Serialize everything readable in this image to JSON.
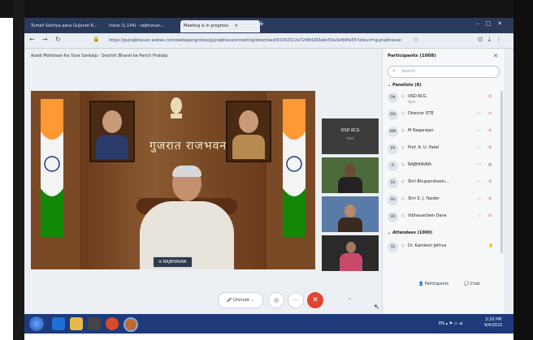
{
  "browser": {
    "tabs": [
      {
        "label": "Tumeli Sahitya aane Gujarati R...",
        "active": false
      },
      {
        "label": "Inbox (1,144) - rajbhavan...",
        "active": false
      },
      {
        "label": "Meeting is in progress",
        "active": true
      }
    ],
    "active_tab_subtitle": "Unmute",
    "url": "https://gujrajbhavan.webex.com/webappng/sites/gujrajbhavan/meeting/download/91932312e72f4fd293abc50a3afb6fa55?siteurl=gujrajbhavan&MTID="
  },
  "meeting": {
    "title": "Azadi Mahotsav Ka Yuva Sankalp - Sreshth Bharat ke Panch Prakalp",
    "banner_text": "गुजरात राजभवन",
    "speaker_label": "RAJBHAVAN",
    "thumbnails": [
      {
        "name": "OSD KCG",
        "sub": "Host"
      }
    ],
    "controls": {
      "unmute_label": "Unmute",
      "more_label": "···"
    }
  },
  "participants": {
    "title": "Participants (1008)",
    "search_placeholder": "Search",
    "panelists_heading": "Panelists (8)",
    "panelists": [
      {
        "initials": "OK",
        "name": "OSD KCG",
        "sub": "Host"
      },
      {
        "initials": "DD",
        "name": "Director DTE",
        "sub": ""
      },
      {
        "initials": "MN",
        "name": "M Nagarajan",
        "sub": ""
      },
      {
        "initials": "PP",
        "name": "Prof. A. U. Patel",
        "sub": ""
      },
      {
        "initials": "R",
        "name": "RAJBHAVAN",
        "sub": ""
      },
      {
        "initials": "SS",
        "name": "Shri Bhupendrasin...",
        "sub": ""
      },
      {
        "initials": "SH",
        "name": "Shri S. J. Haider",
        "sub": ""
      },
      {
        "initials": "VD",
        "name": "Vibhavariben Dave",
        "sub": ""
      }
    ],
    "attendees_heading": "Attendees (1000)",
    "attendees": [
      {
        "initials": "DJ",
        "name": "Dr. Kamlesh Jethva",
        "sub": ""
      }
    ],
    "footer": {
      "participants_label": "Participants",
      "chat_label": "Chat"
    }
  },
  "taskbar": {
    "tray_text": "EN",
    "clock_time": "3:20 PM",
    "clock_date": "9/4/2021"
  },
  "colors": {
    "end_button": "#e2452f",
    "taskbar": "#1e3a7a",
    "saffron": "#ff9933",
    "green": "#138808"
  }
}
